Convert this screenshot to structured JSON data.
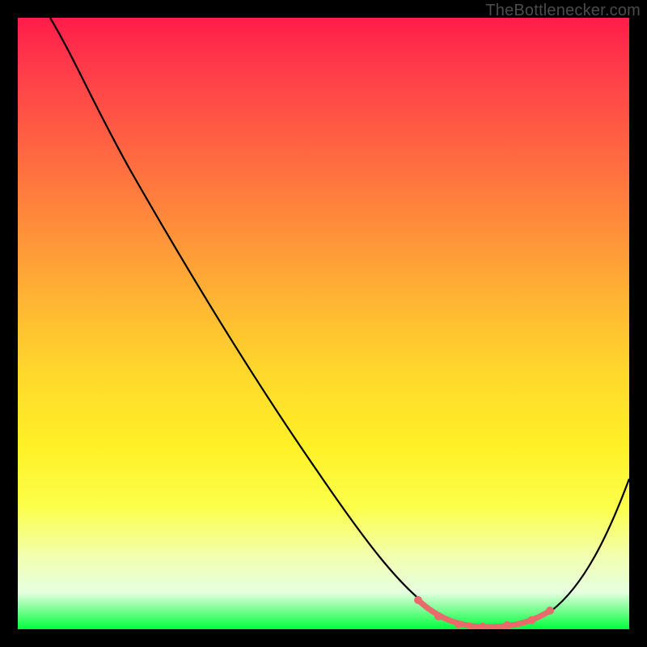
{
  "watermark": "TheBottlenecker.com",
  "colors": {
    "frame_border": "#000000",
    "gradient_top": "#ff1c4a",
    "gradient_bottom": "#00ff3c",
    "line": "#000000",
    "accent": "#e86a6a"
  },
  "chart_data": {
    "type": "line",
    "title": "",
    "xlabel": "",
    "ylabel": "",
    "xlim": [
      0,
      100
    ],
    "ylim": [
      0,
      100
    ],
    "series": [
      {
        "name": "curve",
        "x": [
          5,
          12,
          20,
          30,
          40,
          50,
          60,
          68,
          72,
          76,
          80,
          84,
          88,
          92,
          96,
          100
        ],
        "y": [
          100,
          94,
          85,
          73,
          61,
          49,
          37,
          23,
          12,
          5,
          1,
          0.5,
          1,
          6,
          18,
          34
        ]
      }
    ],
    "highlight_range_x": [
      68,
      88
    ],
    "note": "Values estimated from pixels; y=0 corresponds to the green bottom edge, y=100 to the top."
  }
}
